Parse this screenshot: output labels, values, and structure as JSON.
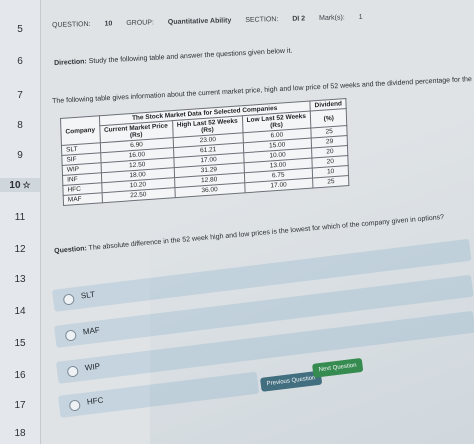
{
  "sidebar": {
    "items": [
      {
        "label": "5"
      },
      {
        "label": "6"
      },
      {
        "label": "7"
      },
      {
        "label": "8"
      },
      {
        "label": "9"
      },
      {
        "label": "10",
        "flag": "☆"
      },
      {
        "label": "11"
      },
      {
        "label": "12"
      },
      {
        "label": "13"
      },
      {
        "label": "14"
      },
      {
        "label": "15"
      },
      {
        "label": "16"
      },
      {
        "label": "17"
      },
      {
        "label": "18"
      }
    ]
  },
  "header": {
    "question_label": "QUESTION:",
    "question_value": "10",
    "group_label": "GROUP:",
    "group_value": "Quantitative Ability",
    "section_label": "SECTION:",
    "section_value": "DI 2",
    "marks_label": "Mark(s):",
    "marks_value": "1"
  },
  "direction": {
    "label": "Direction:",
    "text": "Study the following table and answer the questions given below it."
  },
  "intro": "The following table gives information about the current market price, high and low price of 52 weeks and the dividend percentage for the selected companies.",
  "table": {
    "title": "The Stock Market Data for Selected Companies",
    "headers": {
      "company": "Company",
      "cmp": "Current Market Price",
      "cmp_unit": "(Rs)",
      "high": "High Last 52 Weeks",
      "high_unit": "(Rs)",
      "low": "Low Last 52 Weeks",
      "low_unit": "(Rs)",
      "dividend": "Dividend",
      "dividend_unit": "(%)"
    },
    "rows": [
      {
        "company": "SLT",
        "cmp": "6.90",
        "high": "23.00",
        "low": "6.00",
        "dividend": "25"
      },
      {
        "company": "SIF",
        "cmp": "16.00",
        "high": "61.21",
        "low": "15.00",
        "dividend": "29"
      },
      {
        "company": "WIP",
        "cmp": "12.50",
        "high": "17.00",
        "low": "10.00",
        "dividend": "20"
      },
      {
        "company": "INF",
        "cmp": "18.00",
        "high": "31.29",
        "low": "13.00",
        "dividend": "20"
      },
      {
        "company": "HFC",
        "cmp": "10.20",
        "high": "12.80",
        "low": "6.75",
        "dividend": "10"
      },
      {
        "company": "MAF",
        "cmp": "22.50",
        "high": "36.00",
        "low": "17.00",
        "dividend": "25"
      }
    ]
  },
  "question": {
    "label": "Question:",
    "text": "The absolute difference in the 52 week high and low prices is the lowest for which of the company given in options?"
  },
  "options": [
    {
      "label": "SLT"
    },
    {
      "label": "MAF"
    },
    {
      "label": "WIP"
    },
    {
      "label": "HFC"
    }
  ],
  "buttons": {
    "previous": "Previous Question",
    "next": "Next Question"
  },
  "colors": {
    "next_button": "#2f8a47",
    "previous_button": "#3d6b7c",
    "option_bg": "#c5d4de"
  }
}
